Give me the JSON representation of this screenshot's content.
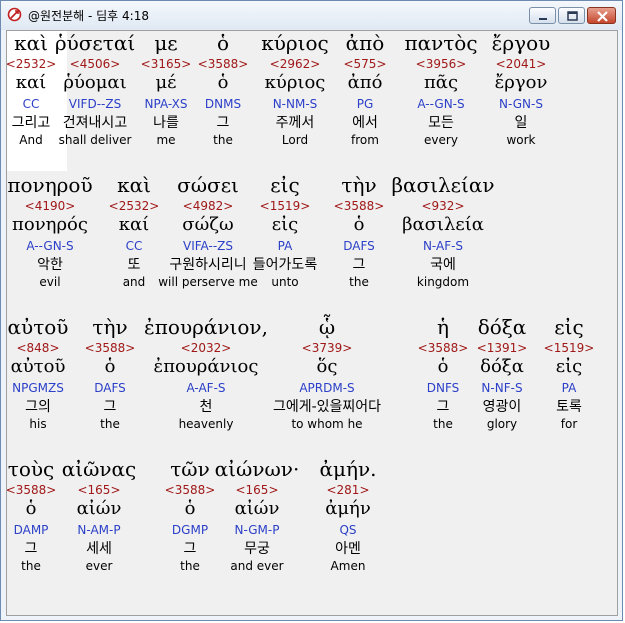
{
  "window": {
    "title": "@원전분해 - 딤후 4:18",
    "buttons": {
      "minimize": "minimize",
      "maximize": "maximize",
      "close": "close"
    }
  },
  "rows": [
    {
      "words": [
        {
          "greek": "καὶ",
          "strong": "<2532>",
          "lemma": "καί",
          "parse": "CC",
          "korean": "그리고",
          "english": "And"
        },
        {
          "greek": "ῥύσεταί",
          "strong": "<4506>",
          "lemma": "ῥύομαι",
          "parse": "VIFD--ZS",
          "korean": "건져내시고",
          "english": "shall deliver"
        },
        {
          "greek": "με",
          "strong": "<3165>",
          "lemma": "μέ",
          "parse": "NPA-XS",
          "korean": "나를",
          "english": "me"
        },
        {
          "greek": "ὁ",
          "strong": "<3588>",
          "lemma": "ὁ",
          "parse": "DNMS",
          "korean": "그",
          "english": "the"
        },
        {
          "greek": "κύριος",
          "strong": "<2962>",
          "lemma": "κύριος",
          "parse": "N-NM-S",
          "korean": "주께서",
          "english": "Lord"
        },
        {
          "greek": "ἀπὸ",
          "strong": "<575>",
          "lemma": "ἀπό",
          "parse": "PG",
          "korean": "에서",
          "english": "from"
        },
        {
          "greek": "παντὸς",
          "strong": "<3956>",
          "lemma": "πᾶς",
          "parse": "A--GN-S",
          "korean": "모든",
          "english": "every"
        },
        {
          "greek": "ἔργου",
          "strong": "<2041>",
          "lemma": "ἔργον",
          "parse": "N-GN-S",
          "korean": "일",
          "english": "work"
        }
      ]
    },
    {
      "words": [
        {
          "greek": "πονηροῦ",
          "strong": "<4190>",
          "lemma": "πονηρός",
          "parse": "A--GN-S",
          "korean": "악한",
          "english": "evil"
        },
        {
          "greek": "καὶ",
          "strong": "<2532>",
          "lemma": "καί",
          "parse": "CC",
          "korean": "또",
          "english": "and"
        },
        {
          "greek": "σώσει",
          "strong": "<4982>",
          "lemma": "σώζω",
          "parse": "VIFA--ZS",
          "korean": "구원하시리니",
          "english": "will perserve me"
        },
        {
          "greek": "εἰς",
          "strong": "<1519>",
          "lemma": "εἰς",
          "parse": "PA",
          "korean": "들어가도록",
          "english": "unto"
        },
        {
          "greek": "τὴν",
          "strong": "<3588>",
          "lemma": "ὁ",
          "parse": "DAFS",
          "korean": "그",
          "english": "the"
        },
        {
          "greek": "βασιλείαν",
          "strong": "<932>",
          "lemma": "βασιλεία",
          "parse": "N-AF-S",
          "korean": "국에",
          "english": "kingdom"
        }
      ]
    },
    {
      "words": [
        {
          "greek": "αὐτοῦ",
          "strong": "<848>",
          "lemma": "αὐτοῦ",
          "parse": "NPGMZS",
          "korean": "그의",
          "english": "his"
        },
        {
          "greek": "τὴν",
          "strong": "<3588>",
          "lemma": "ὁ",
          "parse": "DAFS",
          "korean": "그",
          "english": "the"
        },
        {
          "greek": "ἐπουράνιον,",
          "strong": "<2032>",
          "lemma": "ἐπουράνιος",
          "parse": "A-AF-S",
          "korean": "천",
          "english": "heavenly"
        },
        {
          "greek": "ᾧ",
          "strong": "<3739>",
          "lemma": "ὅς",
          "parse": "APRDM-S",
          "korean": "그에게-있을찌어다",
          "english": "to whom he"
        },
        {
          "greek": "ἡ",
          "strong": "<3588>",
          "lemma": "ὁ",
          "parse": "DNFS",
          "korean": "그",
          "english": "the"
        },
        {
          "greek": "δόξα",
          "strong": "<1391>",
          "lemma": "δόξα",
          "parse": "N-NF-S",
          "korean": "영광이",
          "english": "glory"
        },
        {
          "greek": "εἰς",
          "strong": "<1519>",
          "lemma": "εἰς",
          "parse": "PA",
          "korean": "토록",
          "english": "for"
        }
      ]
    },
    {
      "words": [
        {
          "greek": "τοὺς",
          "strong": "<3588>",
          "lemma": "ὁ",
          "parse": "DAMP",
          "korean": "그",
          "english": "the"
        },
        {
          "greek": "αἰῶνας",
          "strong": "<165>",
          "lemma": "αἰών",
          "parse": "N-AM-P",
          "korean": "세세",
          "english": "ever"
        },
        {
          "greek": "τῶν",
          "strong": "<3588>",
          "lemma": "ὁ",
          "parse": "DGMP",
          "korean": "그",
          "english": "the"
        },
        {
          "greek": "αἰώνων·",
          "strong": "<165>",
          "lemma": "αἰών",
          "parse": "N-GM-P",
          "korean": "무궁",
          "english": "and ever"
        },
        {
          "greek": "ἀμήν.",
          "strong": "<281>",
          "lemma": "ἀμήν",
          "parse": "QS",
          "korean": "아멘",
          "english": "Amen"
        }
      ]
    }
  ]
}
